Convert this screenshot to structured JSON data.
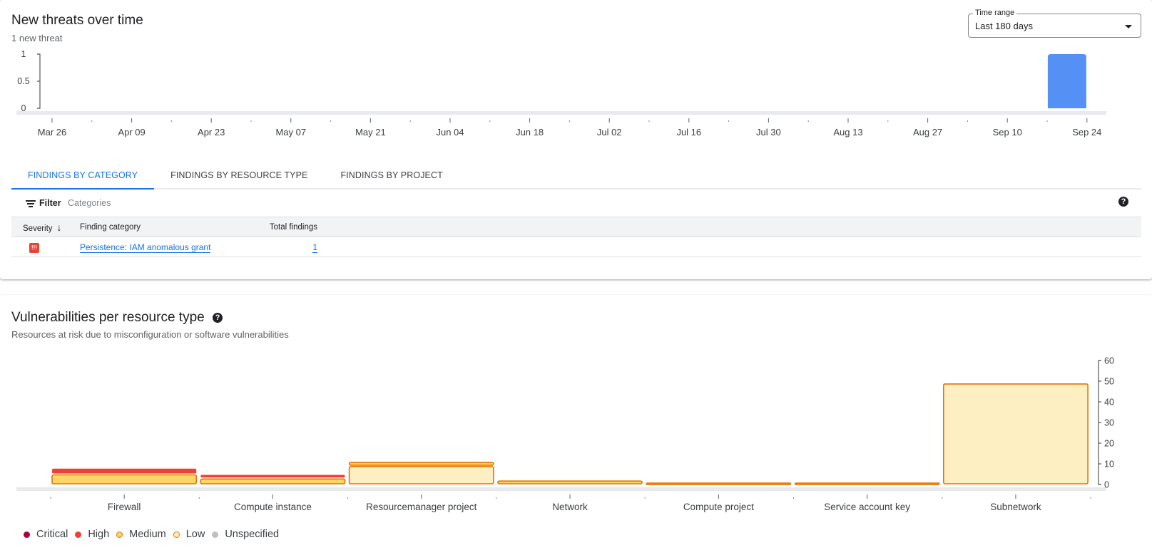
{
  "threats": {
    "title": "New threats over time",
    "subtitle": "1 new threat",
    "time_range": {
      "label": "Time range",
      "value": "Last 180 days"
    },
    "tabs": [
      {
        "label": "FINDINGS BY CATEGORY",
        "active": true
      },
      {
        "label": "FINDINGS BY RESOURCE TYPE",
        "active": false
      },
      {
        "label": "FINDINGS BY PROJECT",
        "active": false
      }
    ],
    "filter": {
      "label": "Filter",
      "placeholder": "Categories",
      "help_icon": "?"
    },
    "table": {
      "columns": [
        "Severity",
        "Finding category",
        "Total findings"
      ],
      "sort_icon": "↓",
      "rows": [
        {
          "severity": "High",
          "severity_glyph": "!!!",
          "category": "Persistence: IAM anomalous grant",
          "total": "1"
        }
      ]
    }
  },
  "vulnerabilities": {
    "title": "Vulnerabilities per resource type",
    "help_icon": "?",
    "subtitle": "Resources at risk due to misconfiguration or software vulnerabilities",
    "legend": [
      {
        "label": "Critical",
        "color": "#b0003a",
        "style": "filled"
      },
      {
        "label": "High",
        "color": "#ea4335",
        "style": "filled"
      },
      {
        "label": "Medium",
        "color": "#fdd663",
        "border": "#e37400",
        "style": "outlined"
      },
      {
        "label": "Low",
        "color": "#feefc3",
        "border": "#e37400",
        "style": "outlined"
      },
      {
        "label": "Unspecified",
        "color": "#bdc1c6",
        "style": "filled"
      }
    ]
  },
  "chart_data": [
    {
      "type": "bar",
      "title": "New threats over time",
      "categories": [
        "Mar 26",
        "Apr 09",
        "Apr 23",
        "May 07",
        "May 21",
        "Jun 04",
        "Jun 18",
        "Jul 02",
        "Jul 16",
        "Jul 30",
        "Aug 13",
        "Aug 27",
        "Sep 10",
        "Sep 24"
      ],
      "bars": [
        {
          "x_between": [
            "Sep 10",
            "Sep 24"
          ],
          "position": 0.75,
          "value": 1
        }
      ],
      "yticks": [
        "0",
        "0.5",
        "1"
      ],
      "ylim": [
        0,
        1
      ],
      "y_axis_side": "left",
      "color": "#5591f5",
      "grid": false
    },
    {
      "type": "bar",
      "stacked": true,
      "title": "Vulnerabilities per resource type",
      "categories": [
        "Firewall",
        "Compute instance",
        "Resourcemanager project",
        "Network",
        "Compute project",
        "Service account key",
        "Subnetwork"
      ],
      "series": [
        {
          "name": "Critical",
          "values": [
            0,
            0,
            0,
            0,
            0,
            0,
            0
          ],
          "color": "#b0003a"
        },
        {
          "name": "High",
          "values": [
            3,
            2,
            0,
            0,
            0,
            0,
            0
          ],
          "color": "#ea4335"
        },
        {
          "name": "Medium",
          "values": [
            5,
            3,
            2,
            2,
            1,
            1,
            0
          ],
          "color": "#fdd663"
        },
        {
          "name": "Low",
          "values": [
            0,
            0,
            9,
            0,
            0,
            0,
            49
          ],
          "color": "#feefc3"
        },
        {
          "name": "Unspecified",
          "values": [
            0,
            0,
            0,
            0,
            0,
            0,
            0
          ],
          "color": "#bdc1c6"
        }
      ],
      "yticks": [
        "0",
        "10",
        "20",
        "30",
        "40",
        "50",
        "60"
      ],
      "ylim": [
        0,
        60
      ],
      "y_axis_side": "right",
      "legend": "bottom-left",
      "grid": false
    }
  ]
}
